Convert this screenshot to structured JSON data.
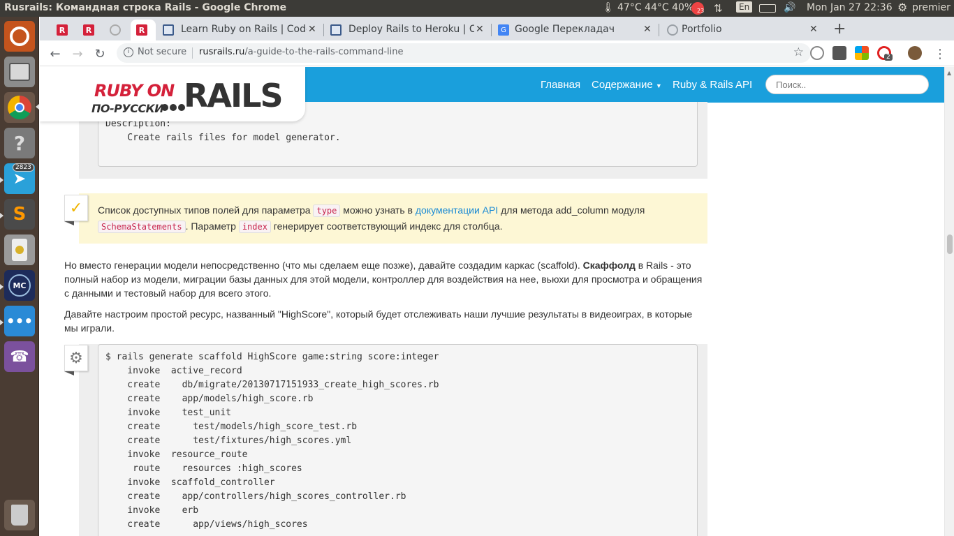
{
  "panel": {
    "window_title": "Rusrails: Командная строка Rails - Google Chrome",
    "temps": "47°C 44°C 40%",
    "notif_count": "23",
    "keyboard_layout": "En",
    "datetime": "Mon Jan 27 22:36",
    "user": "premier"
  },
  "launcher": {
    "telegram_badge": "2823",
    "items": [
      "ubuntu-dash",
      "files",
      "chrome",
      "help",
      "telegram",
      "sublime-text",
      "speaker",
      "mc",
      "messages",
      "viber",
      "trash"
    ]
  },
  "tabs": [
    {
      "title": "",
      "favicon": "rusrails",
      "active": false
    },
    {
      "title": "",
      "favicon": "rusrails",
      "active": false
    },
    {
      "title": "",
      "favicon": "loading",
      "active": false
    },
    {
      "title": "",
      "favicon": "rusrails",
      "active": true
    },
    {
      "title": "Learn Ruby on Rails | Code",
      "favicon": "doc",
      "active": false
    },
    {
      "title": "Deploy Rails to Heroku | C",
      "favicon": "doc",
      "active": false
    },
    {
      "title": "Google Переклaдач",
      "favicon": "translate",
      "active": false
    },
    {
      "title": "Portfolio",
      "favicon": "globe",
      "active": false
    }
  ],
  "toolbar": {
    "not_secure": "Not secure",
    "url_host": "rusrails.ru",
    "url_path": "/a-guide-to-the-rails-command-line",
    "ext_badge": "2"
  },
  "site": {
    "logo_line1": "RUBY ON",
    "logo_line2": "ПО-РУССКИ",
    "logo_rails": "RAILS",
    "nav": {
      "home": "Главная",
      "contents": "Содержание",
      "api": "Ruby & Rails API"
    },
    "search_placeholder": "Поиск.."
  },
  "content": {
    "code1": "Description:\n    Create rails files for model generator.",
    "note": {
      "t1": "Список доступных типов полей для параметра ",
      "code_type": "type",
      "t2": " можно узнать в ",
      "link": "документации API",
      "t3": " для метода add_column модуля",
      "code_schema": "SchemaStatements",
      "t4": ". Параметр ",
      "code_index": "index",
      "t5": " генерирует соответствующий индекс для столбца."
    },
    "para1": {
      "t1": "Но вместо генерации модели непосредственно (что мы сделаем еще позже), давайте создадим каркас (scaffold). ",
      "bold": "Скаффолд",
      "t2": " в Rails - это полный набор из модели, миграции базы данных для этой модели, контроллер для воздействия на нее, вьюхи для просмотра и обращения с данными и тестовый набор для всего этого."
    },
    "para2": "Давайте настроим простой ресурс, названный \"HighScore\", который будет отслеживать наши лучшие результаты в видеоиграх, в которые мы играли.",
    "code2": "$ rails generate scaffold HighScore game:string score:integer\n    invoke  active_record\n    create    db/migrate/20130717151933_create_high_scores.rb\n    create    app/models/high_score.rb\n    invoke    test_unit\n    create      test/models/high_score_test.rb\n    create      test/fixtures/high_scores.yml\n    invoke  resource_route\n     route    resources :high_scores\n    invoke  scaffold_controller\n    create    app/controllers/high_scores_controller.rb\n    invoke    erb\n    create      app/views/high_scores"
  }
}
